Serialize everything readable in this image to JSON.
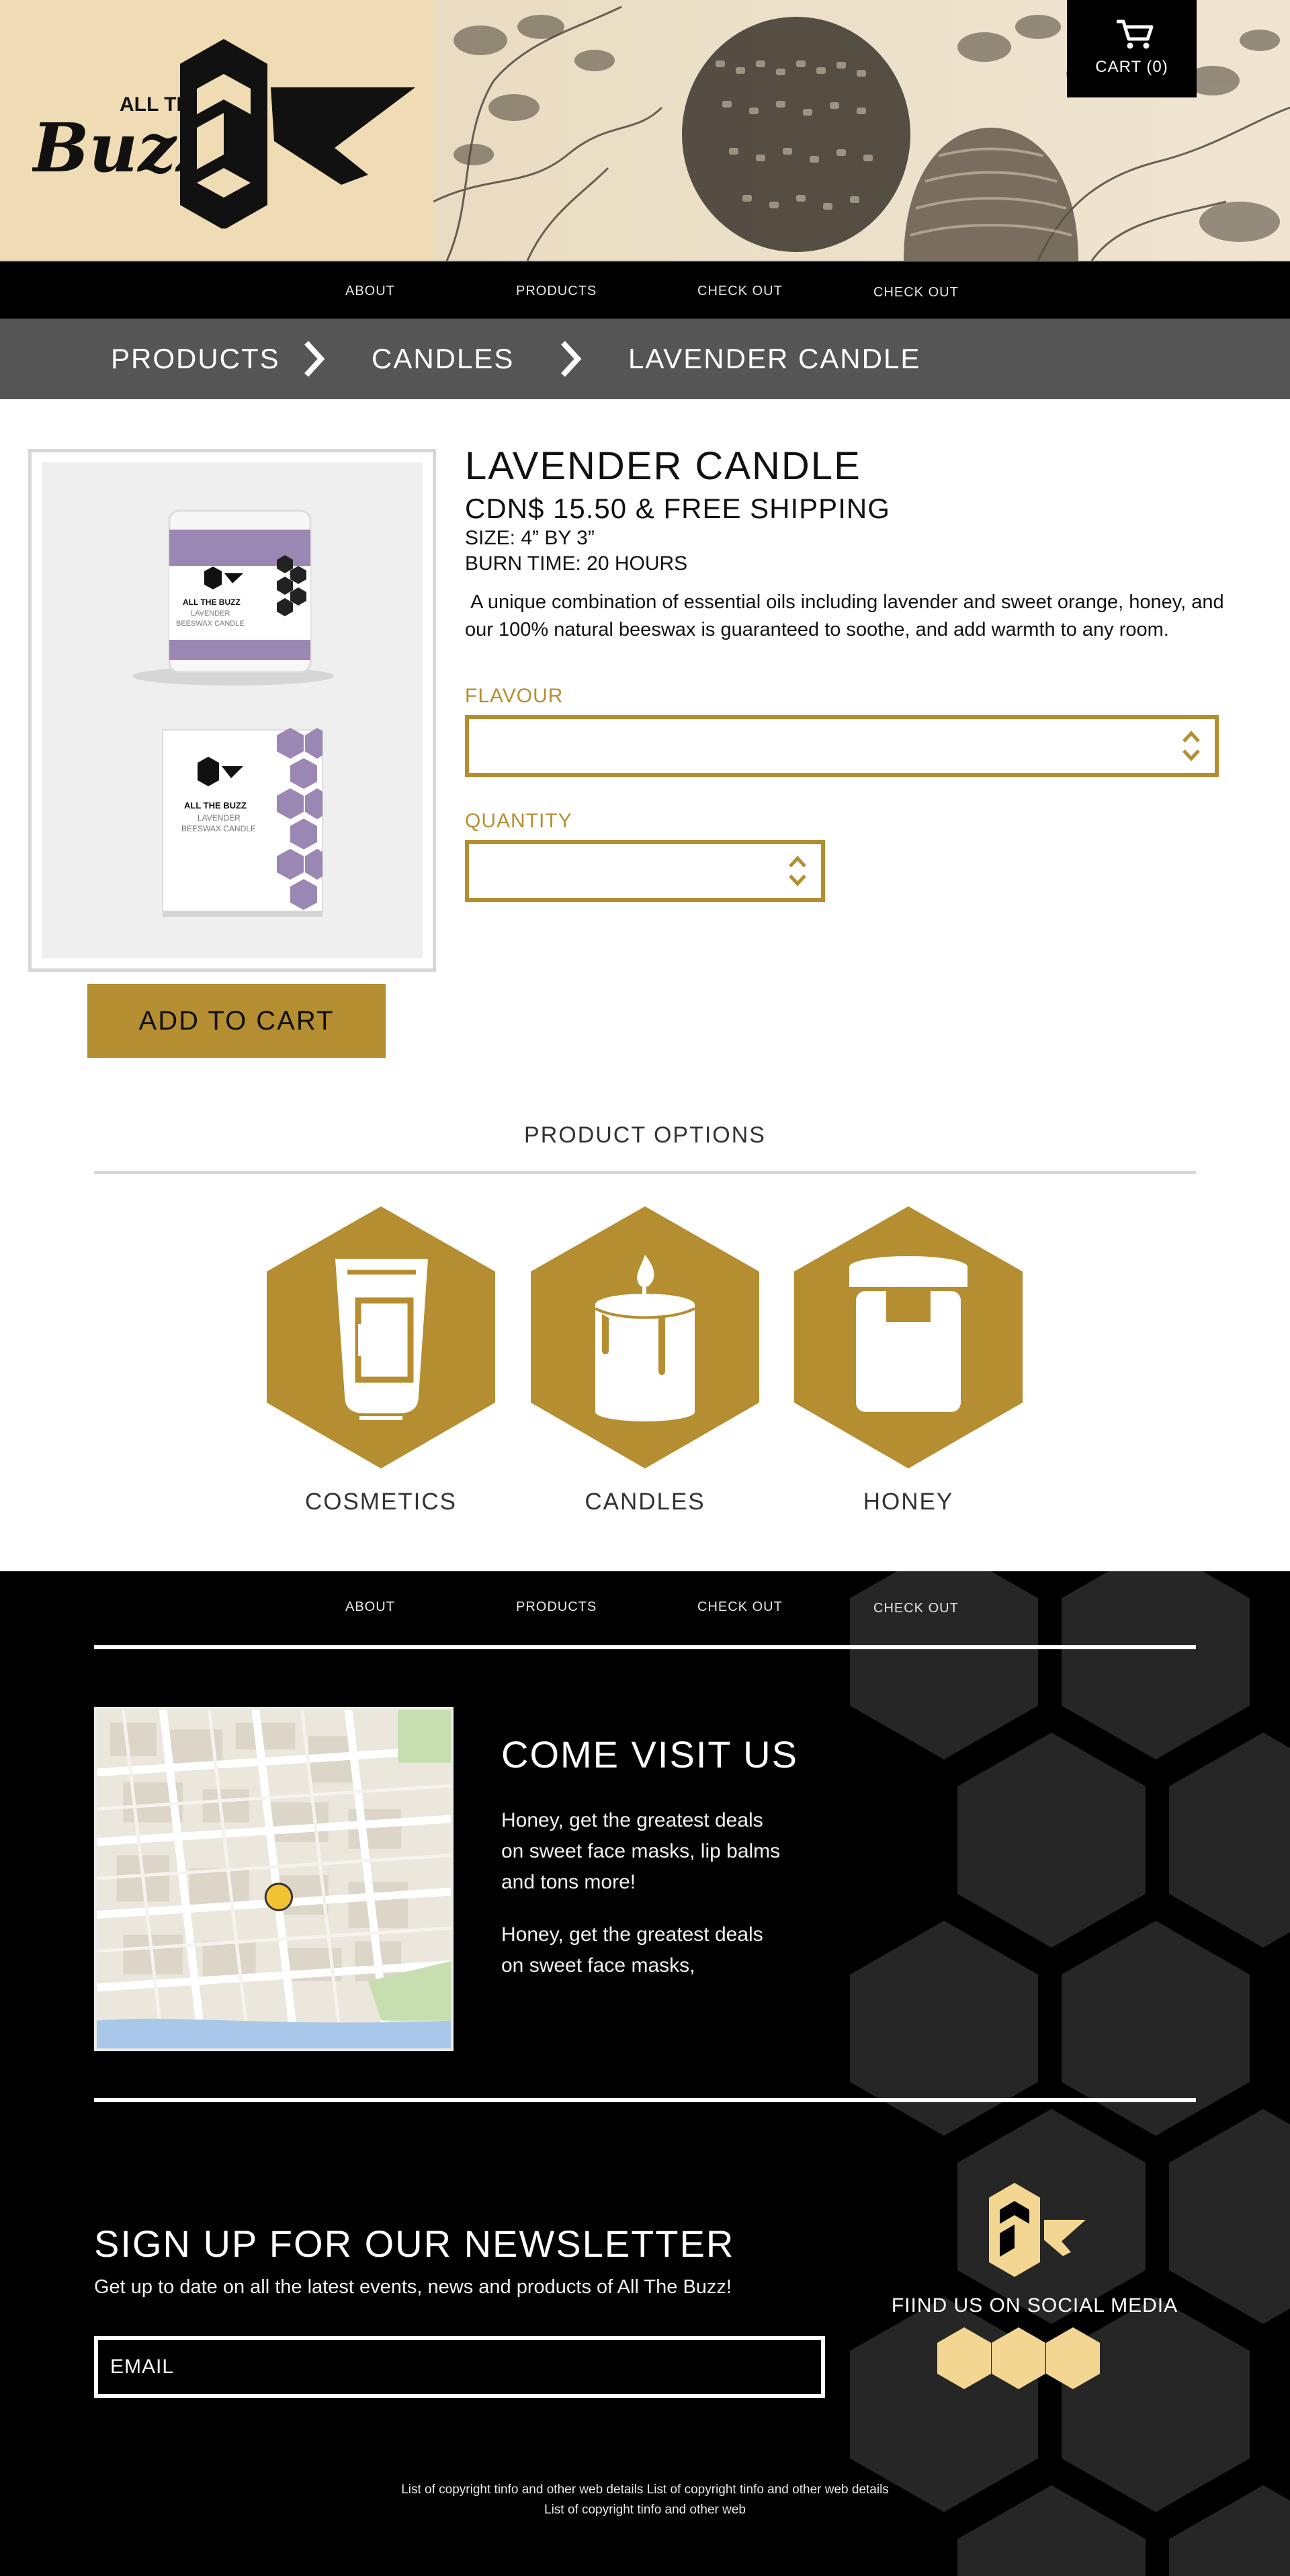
{
  "header": {
    "logo": {
      "line1": "ALL THE",
      "line2": "Buzz"
    },
    "cart_label": "CART (0)"
  },
  "nav": {
    "items": [
      "ABOUT",
      "PRODUCTS",
      "CHECK OUT",
      "CHECK OUT"
    ]
  },
  "breadcrumb": [
    "PRODUCTS",
    "CANDLES",
    "LAVENDER CANDLE"
  ],
  "product": {
    "title": "LAVENDER CANDLE",
    "price": "CDN$ 15.50 & FREE SHIPPING",
    "size": "SIZE: 4” BY 3”",
    "burn_time": "BURN TIME: 20 HOURS",
    "description": " A unique combination of essential oils including lavender and sweet orange, honey, and our 100% natural beeswax is guaranteed to soothe, and add warmth to any room.",
    "image_label": {
      "jar_brand": "ALL THE BUZZ",
      "jar_line1": "LAVENDER",
      "jar_line2": "BEESWAX CANDLE",
      "box_brand": "ALL THE BUZZ",
      "box_line1": "LAVENDER",
      "box_line2": "BEESWAX CANDLE"
    },
    "flavour_label": "FLAVOUR",
    "flavour_value": "",
    "quantity_label": "QUANTITY",
    "quantity_value": "",
    "add_to_cart": "ADD TO CART"
  },
  "options": {
    "heading": "PRODUCT OPTIONS",
    "items": [
      "COSMETICS",
      "CANDLES",
      "HONEY"
    ]
  },
  "footer": {
    "visit_title": "COME VISIT US",
    "visit_text_1": "Honey, get the greatest deals on sweet face masks, lip balms and tons more!",
    "visit_text_2": "Honey, get the greatest deals on sweet face masks,",
    "newsletter_title": "SIGN UP FOR OUR NEWSLETTER",
    "newsletter_sub": "Get up to date on all the latest events, news and products of All The Buzz!",
    "email_placeholder": "EMAIL",
    "social_title": "FIIND US ON SOCIAL MEDIA",
    "copyright_1": "List of copyright tinfo and other web details List of copyright tinfo and other web details",
    "copyright_2": "List of copyright tinfo and other web"
  },
  "colors": {
    "gold": "#b58e31",
    "header_bg": "#efdcb5",
    "breadcrumb_bg": "#555555",
    "hex_dark": "#262626",
    "social_gold": "#f3d692"
  },
  "icons": [
    "cart-icon",
    "chevron-right-icon",
    "up-down-arrows-icon",
    "cosmetics-tube-icon",
    "candle-icon",
    "honey-jar-icon",
    "map-pin-icon",
    "bee-logo-icon"
  ]
}
